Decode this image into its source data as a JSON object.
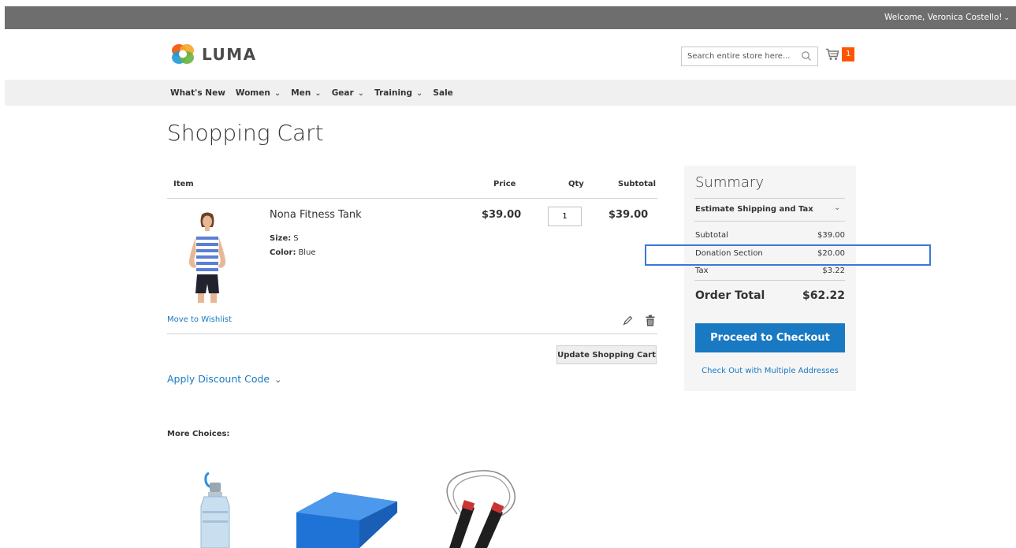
{
  "header": {
    "welcome_text": "Welcome, Veronica Costello!",
    "logo_text": "LUMA",
    "search_placeholder": "Search entire store here...",
    "cart_count": "1"
  },
  "nav": {
    "items": [
      {
        "label": "What's New",
        "dropdown": false
      },
      {
        "label": "Women",
        "dropdown": true
      },
      {
        "label": "Men",
        "dropdown": true
      },
      {
        "label": "Gear",
        "dropdown": true
      },
      {
        "label": "Training",
        "dropdown": true
      },
      {
        "label": "Sale",
        "dropdown": false
      }
    ]
  },
  "page": {
    "title": "Shopping Cart"
  },
  "cart": {
    "columns": [
      "Item",
      "Price",
      "Qty",
      "Subtotal"
    ],
    "items": [
      {
        "name": "Nona Fitness Tank",
        "size_label": "Size:",
        "size": "S",
        "color_label": "Color:",
        "color": "Blue",
        "price": "$39.00",
        "qty": "1",
        "subtotal": "$39.00"
      }
    ],
    "move_to_wishlist": "Move to Wishlist",
    "update_button": "Update Shopping Cart",
    "discount_label": "Apply Discount Code",
    "more_choices": "More Choices:"
  },
  "summary": {
    "title": "Summary",
    "estimate_label": "Estimate Shipping and Tax",
    "rows": {
      "subtotal": {
        "label": "Subtotal",
        "value": "$39.00"
      },
      "donation": {
        "label": "Donation Section",
        "value": "$20.00"
      },
      "tax": {
        "label": "Tax",
        "value": "$3.22"
      },
      "total": {
        "label": "Order Total",
        "value": "$62.22"
      }
    },
    "checkout_button": "Proceed to Checkout",
    "multi_address_link": "Check Out with Multiple Addresses"
  },
  "colors": {
    "link_blue": "#1979c3",
    "cart_badge": "#ff5501",
    "highlight_border": "#3a78d8",
    "top_bar": "#6e6e6e"
  }
}
